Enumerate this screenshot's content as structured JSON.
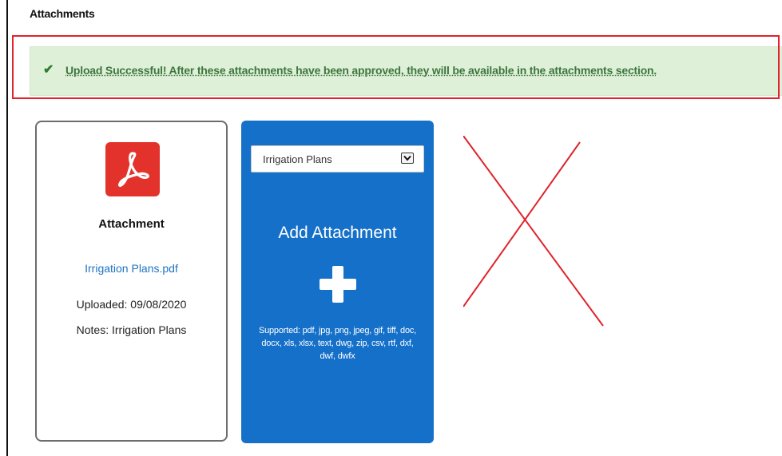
{
  "section": {
    "title": "Attachments"
  },
  "alert": {
    "icon": "check-icon",
    "message": "Upload Successful! After these attachments have been approved, they will be available in the attachments section.",
    "color": "#3c763d",
    "background": "#dff0d8"
  },
  "attachment_card": {
    "icon": "pdf-icon",
    "title": "Attachment",
    "file_name": "Irrigation Plans.pdf",
    "uploaded": "Uploaded: 09/08/2020",
    "notes": "Notes: Irrigation Plans"
  },
  "add_card": {
    "category_select": {
      "selected": "Irrigation Plans"
    },
    "title": "Add Attachment",
    "plus_icon": "plus-icon",
    "supported_text": "Supported: pdf, jpg, png, jpeg, gif, tiff, doc, docx, xls, xlsx, text, dwg, zip, csv, rtf, dxf, dwf, dwfx",
    "background": "#1570c9"
  },
  "annotation": {
    "highlight_color": "#e0242c",
    "x_mark_color": "#e0242c"
  }
}
